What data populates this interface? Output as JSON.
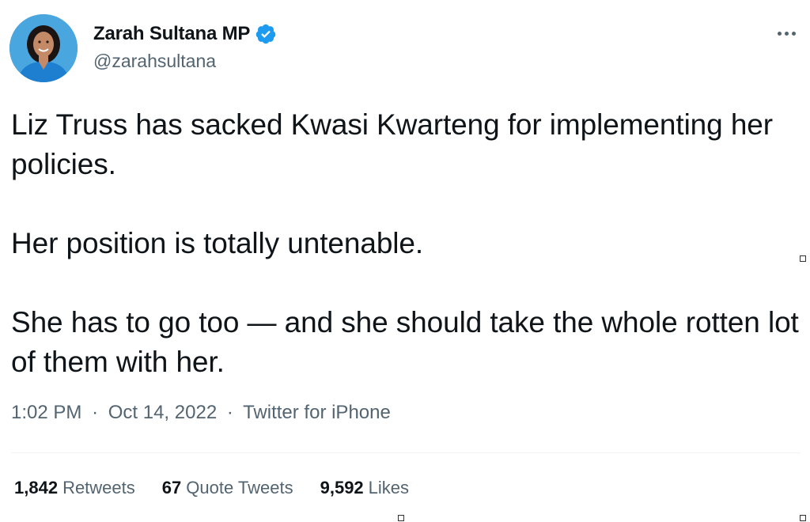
{
  "author": {
    "display_name": "Zarah Sultana MP",
    "handle": "@zarahsultana",
    "verified": true,
    "avatar_icon": "profile-photo"
  },
  "tweet": {
    "paragraphs": [
      "Liz Truss has sacked Kwasi Kwarteng for implementing her policies.",
      "Her position is totally untenable.",
      "She has to go too — and she should take the whole rotten lot of them with her."
    ],
    "time": "1:02 PM",
    "date": "Oct 14, 2022",
    "source": "Twitter for iPhone",
    "separator": "·"
  },
  "stats": {
    "retweets_count": "1,842",
    "retweets_label": "Retweets",
    "quote_count": "67",
    "quote_label": "Quote Tweets",
    "likes_count": "9,592",
    "likes_label": "Likes"
  },
  "colors": {
    "text_primary": "#0f1419",
    "text_secondary": "#536471",
    "verified_blue": "#1d9bf0",
    "divider": "#eff3f4"
  },
  "icons": {
    "verified": "verified-badge-icon",
    "more": "more-horizontal-icon"
  }
}
